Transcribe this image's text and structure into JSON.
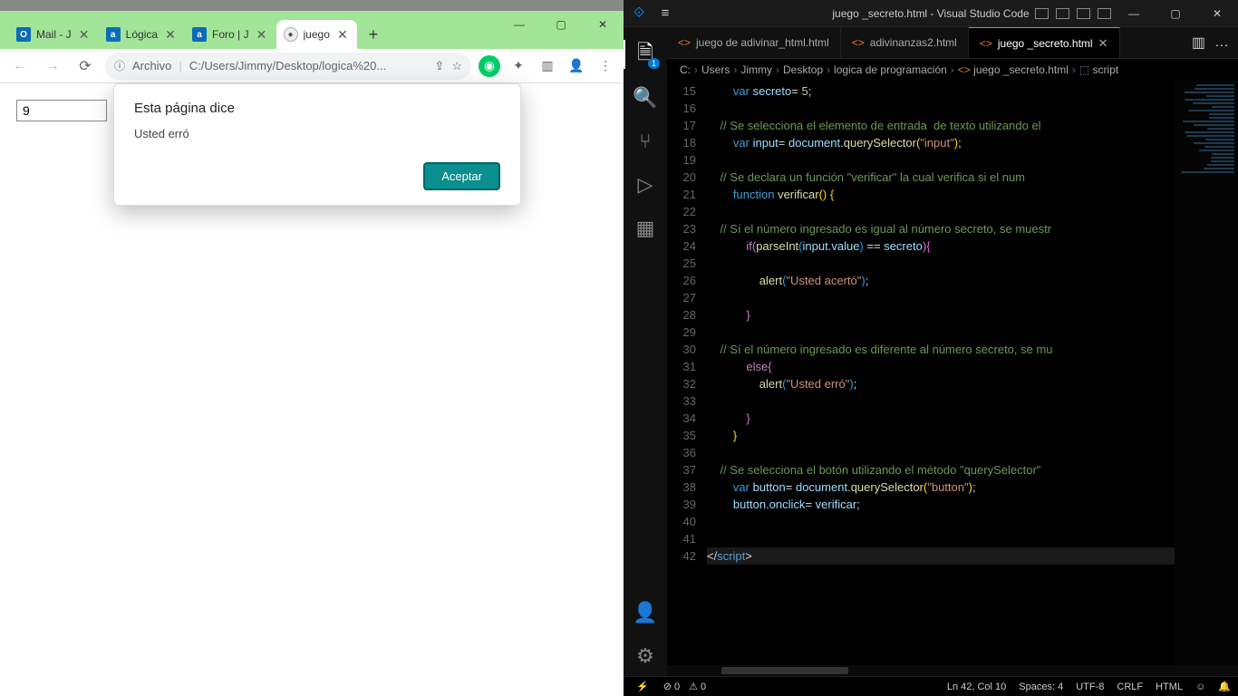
{
  "browser": {
    "tabs": [
      {
        "favicon": "O",
        "title": "Mail - J"
      },
      {
        "favicon": "a",
        "title": "Lógica"
      },
      {
        "favicon": "a",
        "title": "Foro | J"
      },
      {
        "favicon": "●",
        "title": "juego",
        "active": true
      }
    ],
    "window_controls": {
      "min": "—",
      "max": "▢",
      "close": "✕"
    },
    "nav": {
      "back": "←",
      "forward": "→",
      "reload": "⟳"
    },
    "address": {
      "scheme_icon": "ⓘ",
      "scheme": "Archivo",
      "url": "C:/Users/Jimmy/Desktop/logica%20...",
      "share": "⇪",
      "star": "☆"
    },
    "toolbar_icons": {
      "grammarly": "◉",
      "ext": "✦",
      "panel": "▥",
      "profile": "👤",
      "menu": "⋮"
    },
    "page": {
      "input_value": "9"
    },
    "alert": {
      "title": "Esta página dice",
      "message": "Usted erró",
      "ok": "Aceptar"
    }
  },
  "vscode": {
    "titlebar": {
      "menu_icon": "≡",
      "title": "juego _secreto.html - Visual Studio Code",
      "min": "—",
      "max": "▢",
      "close": "✕"
    },
    "activity": [
      {
        "name": "explorer",
        "glyph": "🗎",
        "badge": "1"
      },
      {
        "name": "search",
        "glyph": "🔍"
      },
      {
        "name": "scm",
        "glyph": "⑂"
      },
      {
        "name": "run",
        "glyph": "▷"
      },
      {
        "name": "extensions",
        "glyph": "▦"
      }
    ],
    "activity_bottom": [
      {
        "name": "account",
        "glyph": "👤"
      },
      {
        "name": "settings",
        "glyph": "⚙"
      }
    ],
    "editor_tabs": [
      {
        "label": "juego de adivinar_html.html"
      },
      {
        "label": "adivinanzas2.html"
      },
      {
        "label": "juego _secreto.html",
        "active": true
      }
    ],
    "tab_more": {
      "split": "▥",
      "dots": "…"
    },
    "breadcrumbs": [
      "C:",
      "Users",
      "Jimmy",
      "Desktop",
      "logica de programación",
      "juego _secreto.html",
      "script"
    ],
    "first_line_no": 15,
    "code_lines": [
      {
        "n": 15,
        "html": "        <span class='tk-kw'>var</span> <span class='tk-var'>secreto</span><span class='tk-op'>=</span> <span class='tk-num'>5</span><span class='tk-op'>;</span>"
      },
      {
        "n": 16,
        "html": "    "
      },
      {
        "n": 17,
        "html": "    <span class='tk-cmt'>// Se selecciona el elemento de entrada  de texto utilizando el</span>"
      },
      {
        "n": 18,
        "html": "        <span class='tk-kw'>var</span> <span class='tk-var'>input</span><span class='tk-op'>=</span> <span class='tk-var'>document</span><span class='tk-op'>.</span><span class='tk-fn'>querySelector</span><span class='tk-punc'>(</span><span class='tk-str'>\"input\"</span><span class='tk-punc'>)</span><span class='tk-op'>;</span>"
      },
      {
        "n": 19,
        "html": "    "
      },
      {
        "n": 20,
        "html": "    <span class='tk-cmt'>// Se declara un función \"verificar\" la cual verifica si el num</span>"
      },
      {
        "n": 21,
        "html": "        <span class='tk-kw'>function</span> <span class='tk-fn'>verificar</span><span class='tk-punc'>()</span> <span class='tk-punc'>{</span>"
      },
      {
        "n": 22,
        "html": "    "
      },
      {
        "n": 23,
        "html": "    <span class='tk-cmt'>// Sí el número ingresado es igual al número secreto, se muestr</span>"
      },
      {
        "n": 24,
        "html": "            <span class='tk-ctrl'>if</span><span class='tk-punc2'>(</span><span class='tk-fn'>parseInt</span><span class='tk-punc3'>(</span><span class='tk-var'>input</span><span class='tk-op'>.</span><span class='tk-var'>value</span><span class='tk-punc3'>)</span> <span class='tk-op'>==</span> <span class='tk-var'>secreto</span><span class='tk-punc2'>)</span><span class='tk-punc2'>{</span>"
      },
      {
        "n": 25,
        "html": "    "
      },
      {
        "n": 26,
        "html": "                <span class='tk-fn'>alert</span><span class='tk-punc3'>(</span><span class='tk-str'>\"Usted acertó\"</span><span class='tk-punc3'>)</span><span class='tk-op'>;</span>"
      },
      {
        "n": 27,
        "html": "    "
      },
      {
        "n": 28,
        "html": "            <span class='tk-punc2'>}</span>"
      },
      {
        "n": 29,
        "html": "    "
      },
      {
        "n": 30,
        "html": "    <span class='tk-cmt'>// Sí el número ingresado es diferente al número secreto, se mu</span>"
      },
      {
        "n": 31,
        "html": "            <span class='tk-ctrl'>else</span><span class='tk-punc2'>{</span>"
      },
      {
        "n": 32,
        "html": "                <span class='tk-fn'>alert</span><span class='tk-punc3'>(</span><span class='tk-str'>\"Usted erró\"</span><span class='tk-punc3'>)</span><span class='tk-op'>;</span>"
      },
      {
        "n": 33,
        "html": "    "
      },
      {
        "n": 34,
        "html": "            <span class='tk-punc2'>}</span>"
      },
      {
        "n": 35,
        "html": "        <span class='tk-punc'>}</span>"
      },
      {
        "n": 36,
        "html": "    "
      },
      {
        "n": 37,
        "html": "    <span class='tk-cmt'>// Se selecciona el botón utilizando el método \"querySelector\"</span>"
      },
      {
        "n": 38,
        "html": "        <span class='tk-kw'>var</span> <span class='tk-var'>button</span><span class='tk-op'>=</span> <span class='tk-var'>document</span><span class='tk-op'>.</span><span class='tk-fn'>querySelector</span><span class='tk-punc'>(</span><span class='tk-str'>\"button\"</span><span class='tk-punc'>)</span><span class='tk-op'>;</span>"
      },
      {
        "n": 39,
        "html": "        <span class='tk-var'>button</span><span class='tk-op'>.</span><span class='tk-var'>onclick</span><span class='tk-op'>=</span> <span class='tk-var'>verificar</span><span class='tk-op'>;</span>"
      },
      {
        "n": 40,
        "html": "    "
      },
      {
        "n": 41,
        "html": "    "
      },
      {
        "n": 42,
        "html": "<span class='line-hi'><span class='tk-op'>&lt;/</span><span class='tk-tag'>script</span><span class='tk-op'>&gt;</span></span>"
      }
    ],
    "statusbar": {
      "remote": "⚡",
      "errors": "⊘ 0",
      "warnings": "⚠ 0",
      "cursor": "Ln 42, Col 10",
      "spaces": "Spaces: 4",
      "encoding": "UTF-8",
      "eol": "CRLF",
      "lang": "HTML",
      "feedback": "☺",
      "bell": "🔔"
    }
  }
}
